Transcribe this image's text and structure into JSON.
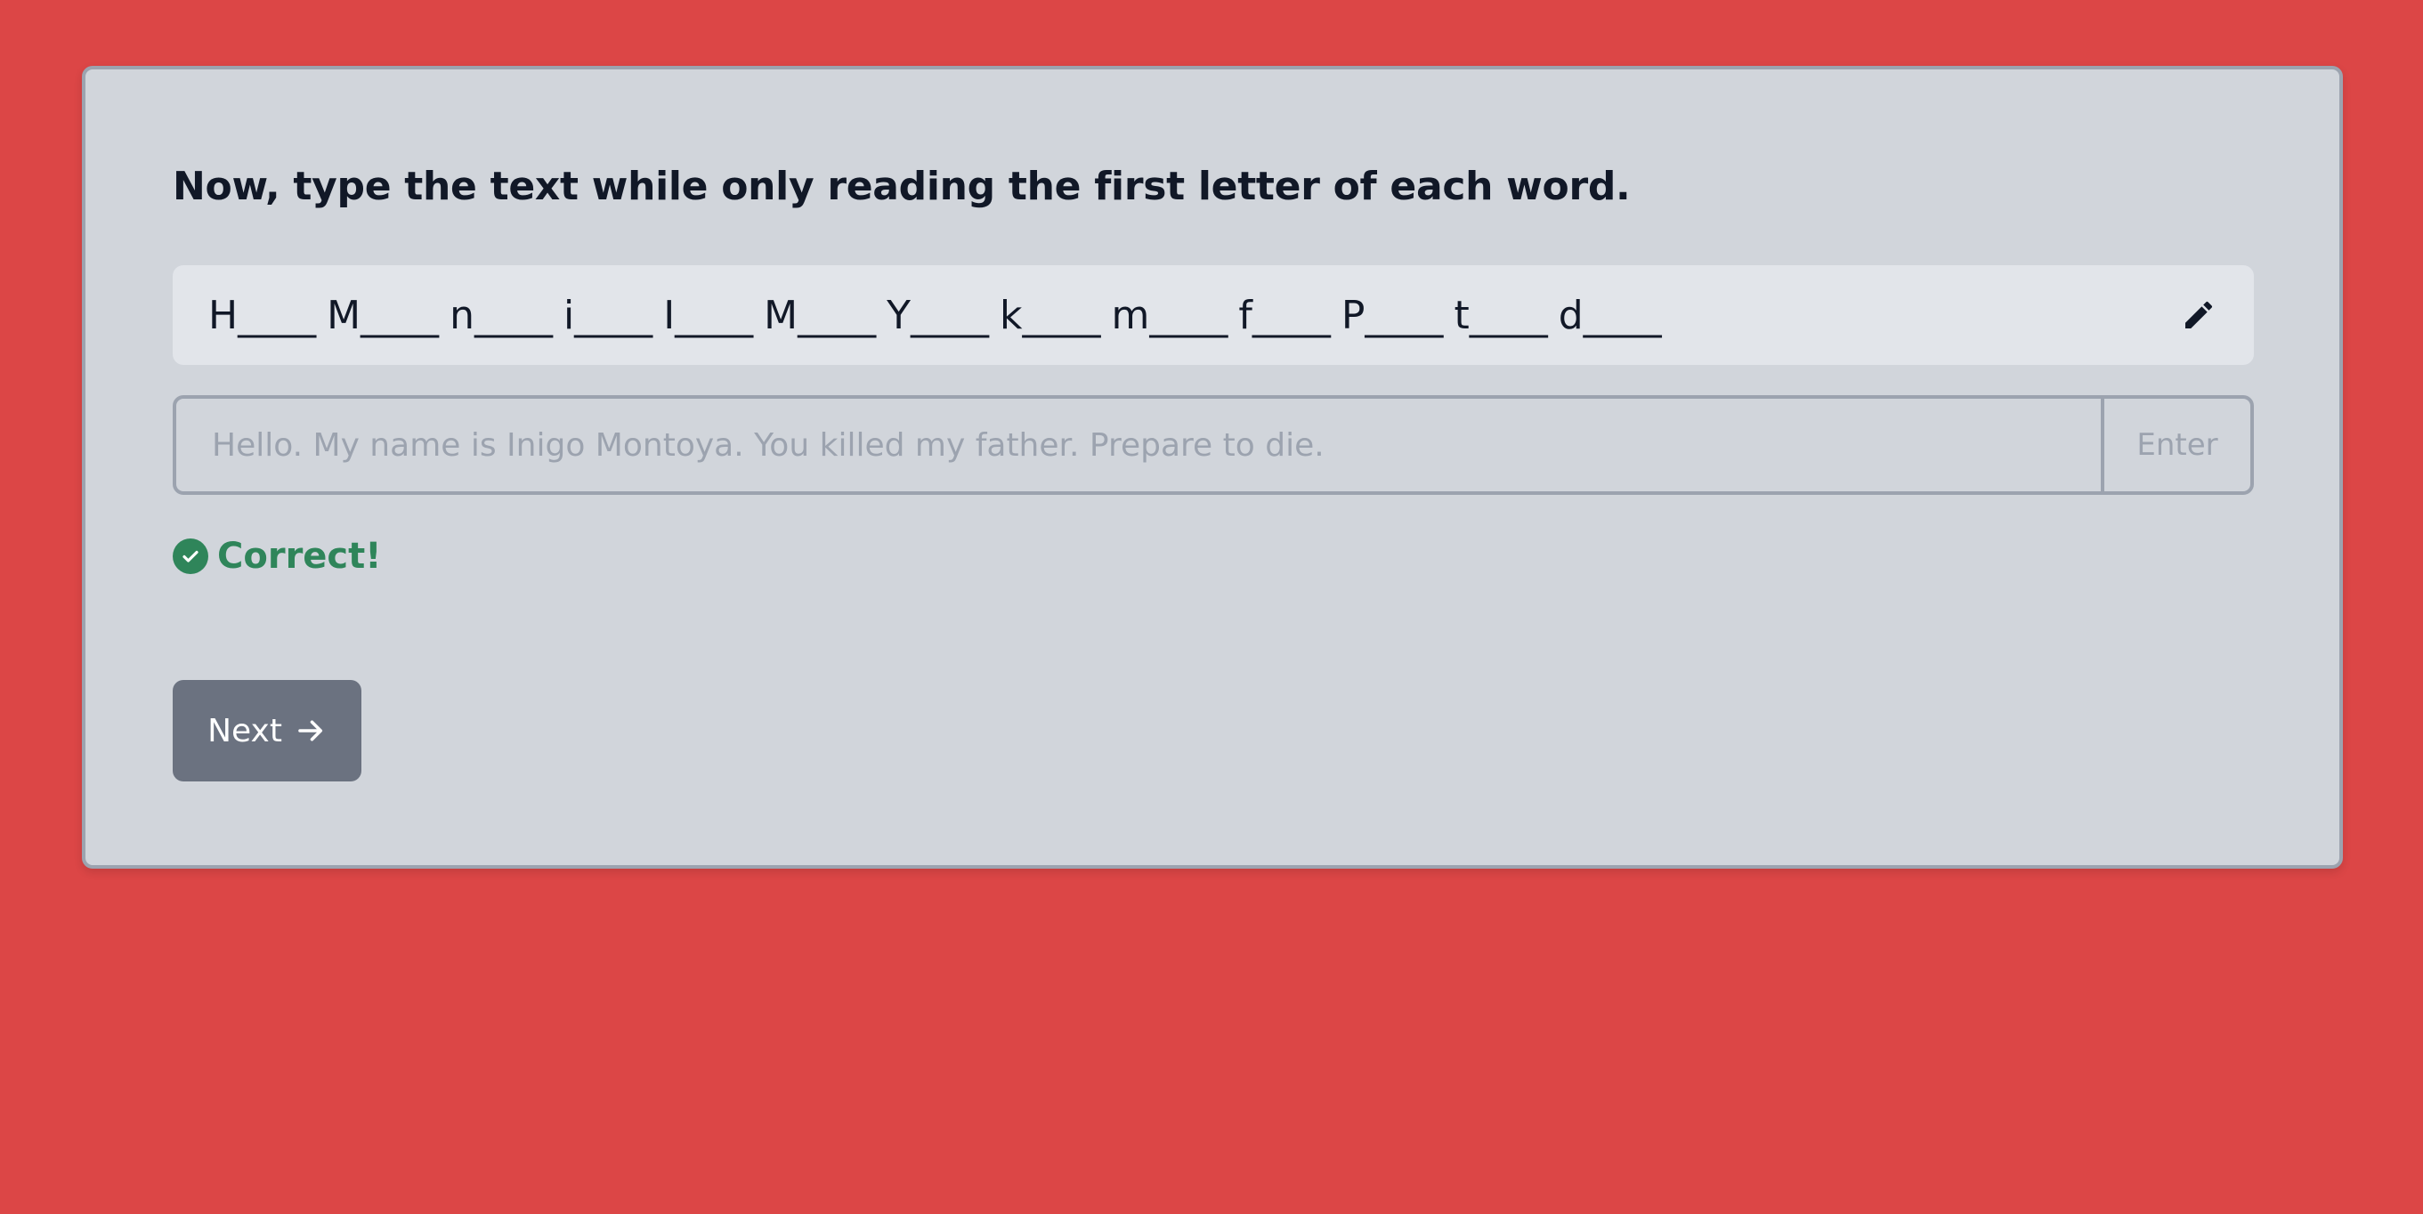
{
  "instruction": "Now, type the text while only reading the first letter of each word.",
  "hint": {
    "words": [
      "H____",
      "M____",
      "n____",
      "i____",
      "I____",
      "M____",
      "Y____",
      "k____",
      "m____",
      "f____",
      "P____",
      "t____",
      "d____"
    ],
    "edit_icon": "pencil-icon"
  },
  "answer_input": {
    "value": "",
    "placeholder": "Hello. My name is Inigo Montoya. You killed my father. Prepare to die.",
    "submit_label": "Enter"
  },
  "feedback": {
    "icon": "check-circle-icon",
    "text": "Correct!",
    "color": "#2f855a"
  },
  "next_button": {
    "label": "Next",
    "icon": "arrow-right-icon"
  },
  "colors": {
    "background": "#dc4646",
    "card": "#d1d5db",
    "card_border": "#9ca3af",
    "hint_box": "#e2e5ea",
    "button": "#6b7280",
    "text": "#111827"
  }
}
